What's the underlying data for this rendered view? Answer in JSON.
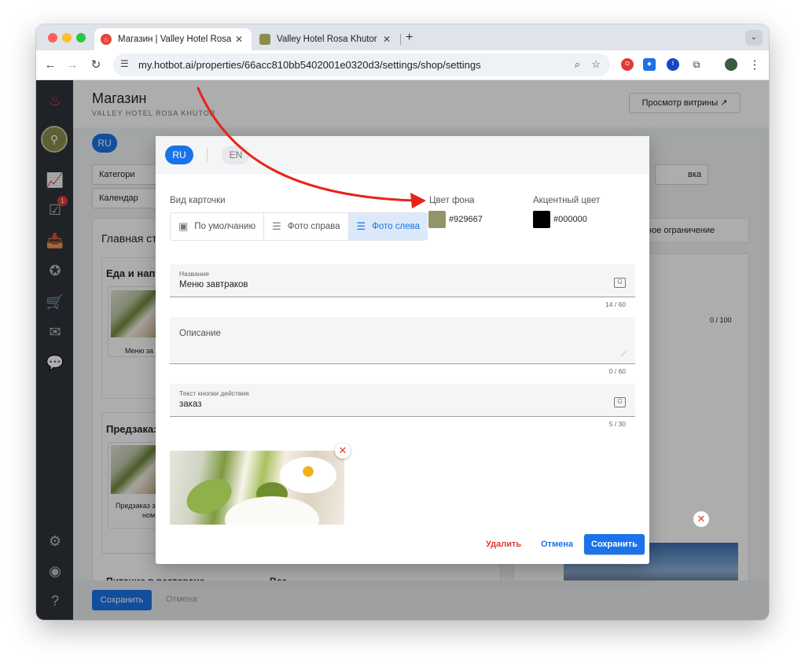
{
  "browser": {
    "tabs": [
      {
        "title": "Магазин | Valley Hotel Rosa Khutor",
        "active": true
      },
      {
        "title": "Valley Hotel Rosa Khutor",
        "active": false
      }
    ],
    "url": "my.hotbot.ai/properties/66acc810bb5402001e0320d3/settings/shop/settings"
  },
  "app": {
    "page_title": "Магазин",
    "page_subtitle": "VALLEY HOTEL ROSA KHUTOR",
    "preview_button": "Просмотр витрины ↗",
    "sidebar_badge": "1",
    "background": {
      "lang_pill": "RU",
      "chips": [
        "Категори",
        "Календар",
        "вка"
      ],
      "main_heading": "Главная ст",
      "section1": "Еда и напит",
      "card1_label": "Меню за",
      "section2": "Предзаказ",
      "card2_label1": "Предзаказ з",
      "card2_label2": "ном",
      "section3": "Питание в ресторане",
      "section3_tail": "Все",
      "right_text": "ное ограничение",
      "right_counter": "0 / 100",
      "save": "Сохранить",
      "cancel": "Отмена"
    }
  },
  "modal": {
    "langs": [
      "RU",
      "EN"
    ],
    "card_view_label": "Вид карточки",
    "card_view_options": [
      {
        "label": "По умолчанию",
        "icon": "image-icon",
        "selected": false
      },
      {
        "label": "Фото справа",
        "icon": "align-right-icon",
        "selected": false
      },
      {
        "label": "Фото слева",
        "icon": "align-left-icon",
        "selected": true
      }
    ],
    "bg_color_label": "Цвет фона",
    "bg_color": "#929667",
    "accent_color_label": "Акцентный цвет",
    "accent_color": "#000000",
    "name_field": {
      "label": "Название",
      "value": "Меню завтраков",
      "counter": "14 / 60"
    },
    "description_field": {
      "placeholder": "Описание",
      "counter": "0 / 60"
    },
    "action_field": {
      "label": "Текст кнопки действия",
      "value": "заказ",
      "counter": "5 / 30"
    },
    "buttons": {
      "delete": "Удалить",
      "cancel": "Отмена",
      "save": "Сохранить"
    }
  },
  "colors": {
    "accent_blue": "#1a73e8",
    "danger": "#e53935",
    "annotation_arrow": "#e8231a"
  }
}
